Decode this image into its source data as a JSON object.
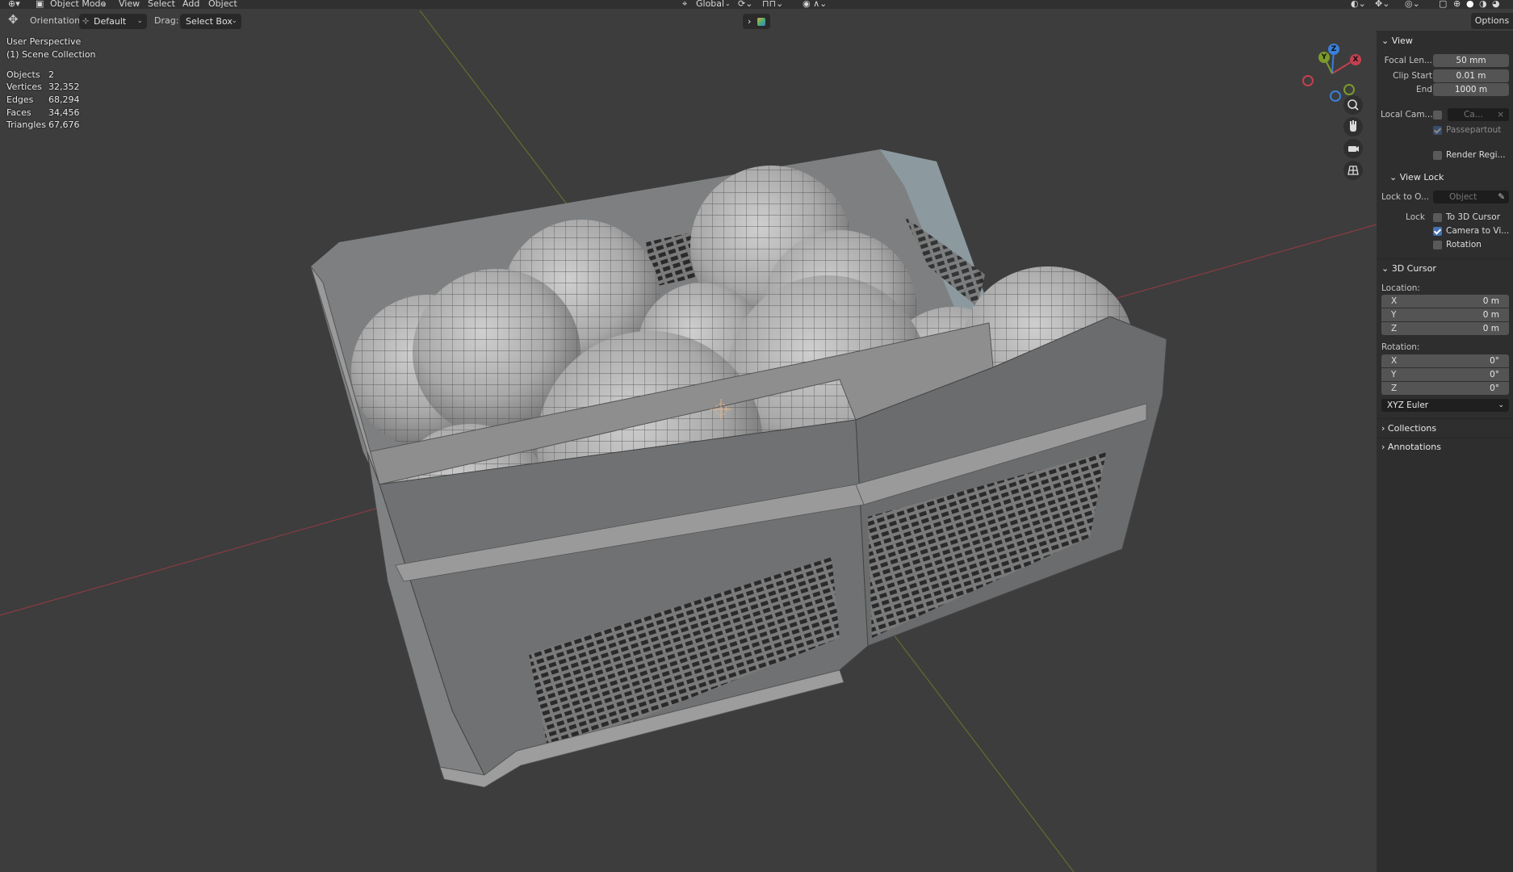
{
  "header": {
    "mode": "Object Mode",
    "menus": [
      "View",
      "Select",
      "Add",
      "Object"
    ],
    "transform_orientation": "Global"
  },
  "toolbar": {
    "orientation_label": "Orientation:",
    "orientation_value": "Default",
    "drag_label": "Drag:",
    "drag_value": "Select Box",
    "options_label": "Options"
  },
  "viewport": {
    "view_name": "User Perspective",
    "collection": "(1) Scene Collection",
    "stats": [
      {
        "label": "Objects",
        "value": "2"
      },
      {
        "label": "Vertices",
        "value": "32,352"
      },
      {
        "label": "Edges",
        "value": "68,294"
      },
      {
        "label": "Faces",
        "value": "34,456"
      },
      {
        "label": "Triangles",
        "value": "67,676"
      }
    ],
    "gizmo_axes": {
      "x": "X",
      "y": "Y",
      "z": "Z"
    },
    "colors": {
      "background": "#3d3d3d",
      "x_axis": "#c2404f",
      "y_axis": "#7a9a2c",
      "z_axis": "#3a7fd8"
    }
  },
  "panel": {
    "view_header": "View",
    "focal_length_label": "Focal Len...",
    "focal_length_value": "50 mm",
    "clip_start_label": "Clip Start",
    "clip_start_value": "0.01 m",
    "clip_end_label": "End",
    "clip_end_value": "1000 m",
    "local_camera_label": "Local Cam...",
    "local_camera_value": "Ca...",
    "passepartout_label": "Passepartout",
    "render_region_label": "Render Regi...",
    "view_lock_header": "View Lock",
    "lock_to_object_label": "Lock to O...",
    "lock_to_object_placeholder": "Object",
    "lock_label": "Lock",
    "lock_options": [
      {
        "label": "To 3D Cursor",
        "checked": false
      },
      {
        "label": "Camera to Vi...",
        "checked": true
      },
      {
        "label": "Rotation",
        "checked": false
      }
    ],
    "cursor_header": "3D Cursor",
    "location_label": "Location:",
    "location": [
      {
        "axis": "X",
        "value": "0 m"
      },
      {
        "axis": "Y",
        "value": "0 m"
      },
      {
        "axis": "Z",
        "value": "0 m"
      }
    ],
    "rotation_label": "Rotation:",
    "rotation": [
      {
        "axis": "X",
        "value": "0°"
      },
      {
        "axis": "Y",
        "value": "0°"
      },
      {
        "axis": "Z",
        "value": "0°"
      }
    ],
    "rotation_mode": "XYZ Euler",
    "collections_header": "Collections",
    "annotations_header": "Annotations",
    "accent_color": "#4772b3"
  }
}
